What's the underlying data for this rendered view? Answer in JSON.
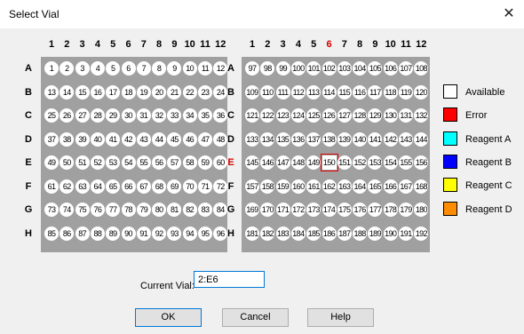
{
  "window": {
    "title": "Select Vial",
    "close_glyph": "✕"
  },
  "plates": [
    {
      "columns": [
        "1",
        "2",
        "3",
        "4",
        "5",
        "6",
        "7",
        "8",
        "9",
        "10",
        "11",
        "12"
      ],
      "rows": [
        "A",
        "B",
        "C",
        "D",
        "E",
        "F",
        "G",
        "H"
      ],
      "wells": [
        [
          "1",
          "2",
          "3",
          "4",
          "5",
          "6",
          "7",
          "8",
          "9",
          "10",
          "11",
          "12"
        ],
        [
          "13",
          "14",
          "15",
          "16",
          "17",
          "18",
          "19",
          "20",
          "21",
          "22",
          "23",
          "24"
        ],
        [
          "25",
          "26",
          "27",
          "28",
          "29",
          "30",
          "31",
          "32",
          "33",
          "34",
          "35",
          "36"
        ],
        [
          "37",
          "38",
          "39",
          "40",
          "41",
          "42",
          "43",
          "44",
          "45",
          "46",
          "47",
          "48"
        ],
        [
          "49",
          "50",
          "51",
          "52",
          "53",
          "54",
          "55",
          "56",
          "57",
          "58",
          "59",
          "60"
        ],
        [
          "61",
          "62",
          "63",
          "64",
          "65",
          "66",
          "67",
          "68",
          "69",
          "70",
          "71",
          "72"
        ],
        [
          "73",
          "74",
          "75",
          "76",
          "77",
          "78",
          "79",
          "80",
          "81",
          "82",
          "83",
          "84"
        ],
        [
          "85",
          "86",
          "87",
          "88",
          "89",
          "90",
          "91",
          "92",
          "93",
          "94",
          "95",
          "96"
        ]
      ]
    },
    {
      "columns": [
        "1",
        "2",
        "3",
        "4",
        "5",
        "6",
        "7",
        "8",
        "9",
        "10",
        "11",
        "12"
      ],
      "rows": [
        "A",
        "B",
        "C",
        "D",
        "E",
        "F",
        "G",
        "H"
      ],
      "wells": [
        [
          "97",
          "98",
          "99",
          "100",
          "101",
          "102",
          "103",
          "104",
          "105",
          "106",
          "107",
          "108"
        ],
        [
          "109",
          "110",
          "111",
          "112",
          "113",
          "114",
          "115",
          "116",
          "117",
          "118",
          "119",
          "120"
        ],
        [
          "121",
          "122",
          "123",
          "124",
          "125",
          "126",
          "127",
          "128",
          "129",
          "130",
          "131",
          "132"
        ],
        [
          "133",
          "134",
          "135",
          "136",
          "137",
          "138",
          "139",
          "140",
          "141",
          "142",
          "143",
          "144"
        ],
        [
          "145",
          "146",
          "147",
          "148",
          "149",
          "150",
          "151",
          "152",
          "153",
          "154",
          "155",
          "156"
        ],
        [
          "157",
          "158",
          "159",
          "160",
          "161",
          "162",
          "163",
          "164",
          "165",
          "166",
          "167",
          "168"
        ],
        [
          "169",
          "170",
          "171",
          "172",
          "173",
          "174",
          "175",
          "176",
          "177",
          "178",
          "179",
          "180"
        ],
        [
          "181",
          "182",
          "183",
          "184",
          "185",
          "186",
          "187",
          "188",
          "189",
          "190",
          "191",
          "192"
        ]
      ],
      "selected": {
        "row": "E",
        "column": "6"
      }
    }
  ],
  "legend": [
    {
      "label": "Available",
      "color": "#ffffff"
    },
    {
      "label": "Error",
      "color": "#ff0000"
    },
    {
      "label": "Reagent A",
      "color": "#00ffff"
    },
    {
      "label": "Reagent B",
      "color": "#0000ff"
    },
    {
      "label": "Reagent C",
      "color": "#ffff00"
    },
    {
      "label": "Reagent D",
      "color": "#ff8c00"
    }
  ],
  "current_vial": {
    "label": "Current Vial:",
    "value": "2:E6"
  },
  "buttons": {
    "ok": "OK",
    "cancel": "Cancel",
    "help": "Help"
  }
}
